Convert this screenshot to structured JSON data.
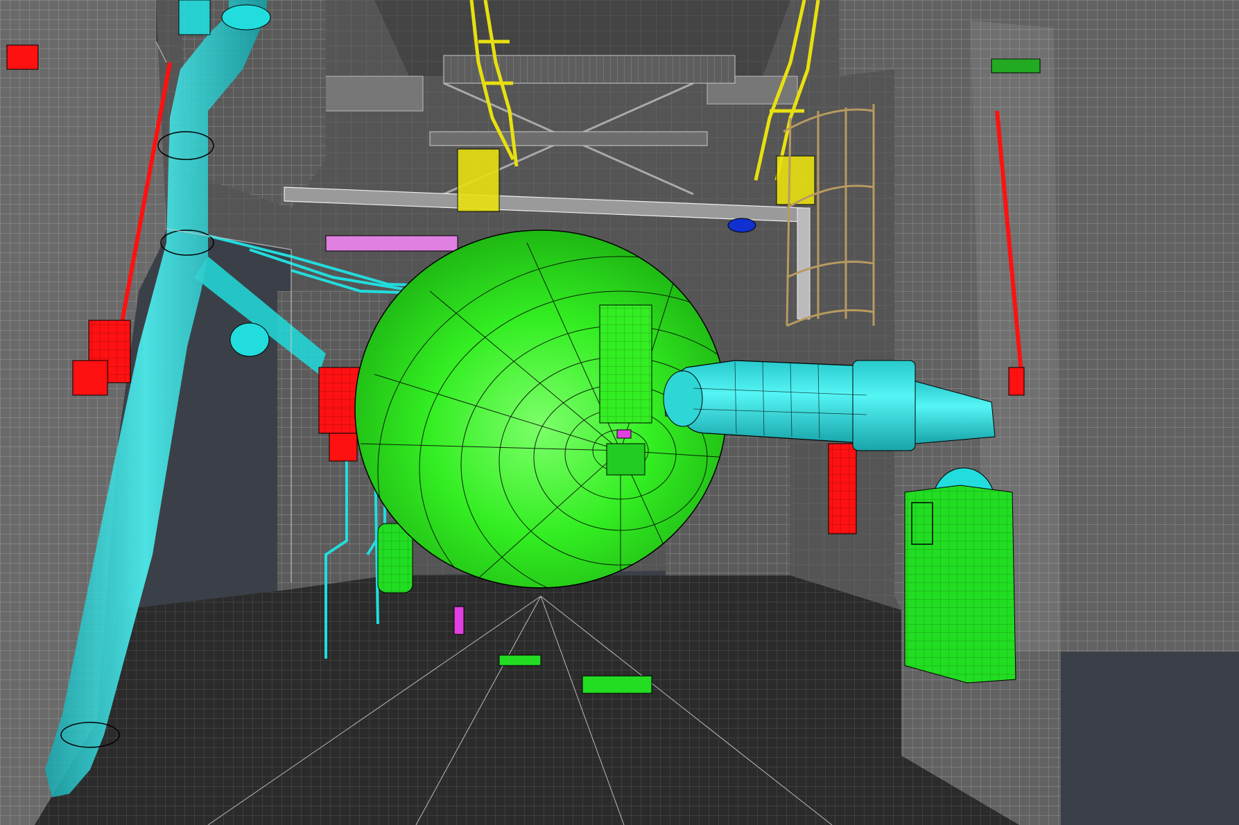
{
  "viewport": {
    "render_mode": "wireframe-shaded",
    "background_color": "#3b4048"
  },
  "palette": {
    "vessel": "#33ee22",
    "equipment_green": "#22dd22",
    "piping": "#22dddd",
    "fire_equipment": "#ff1111",
    "handrail": "#e8e010",
    "ladder": "#b89a60",
    "valve_magenta": "#e040e0",
    "instrument_blue": "#1030d0",
    "steel_grey": "#5c5c5c",
    "wall_grey": "#6a6a6a",
    "floor_dark": "#2a2a2a",
    "edge_black": "#000000",
    "edge_light": "#cfcfcf"
  },
  "objects": [
    {
      "name": "spherical-vessel",
      "color": "vessel"
    },
    {
      "name": "horizontal-cyan-duct",
      "color": "piping"
    },
    {
      "name": "vertical-cyan-pipe",
      "color": "piping"
    },
    {
      "name": "small-bore-piping",
      "color": "piping"
    },
    {
      "name": "red-fire-cabinet",
      "color": "fire_equipment"
    },
    {
      "name": "yellow-handrail",
      "color": "handrail"
    },
    {
      "name": "caged-ladder",
      "color": "ladder"
    },
    {
      "name": "green-equipment-skid",
      "color": "equipment_green"
    },
    {
      "name": "green-small-tank",
      "color": "equipment_green"
    },
    {
      "name": "steel-frame",
      "color": "steel_grey"
    },
    {
      "name": "floor-grating",
      "color": "floor_dark"
    }
  ]
}
